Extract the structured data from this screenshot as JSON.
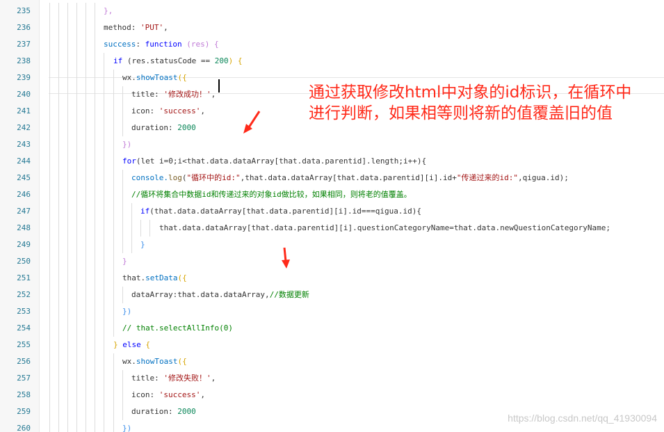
{
  "editor": {
    "lines": [
      {
        "n": "235",
        "tokens": [
          {
            "t": "},",
            "c": "br1"
          }
        ]
      },
      {
        "n": "236",
        "tokens": [
          {
            "t": "method",
            "c": "prop"
          },
          {
            "t": ": ",
            "c": ""
          },
          {
            "t": "'PUT'",
            "c": "str"
          },
          {
            "t": ",",
            "c": ""
          }
        ]
      },
      {
        "n": "237",
        "tokens": [
          {
            "t": "success",
            "c": "idt"
          },
          {
            "t": ": ",
            "c": ""
          },
          {
            "t": "function",
            "c": "kw"
          },
          {
            "t": " (res) {",
            "c": "br1"
          }
        ]
      },
      {
        "n": "238",
        "tokens": [
          {
            "t": "if",
            "c": "kw"
          },
          {
            "t": " (res.statusCode == ",
            "c": ""
          },
          {
            "t": "200",
            "c": "num"
          },
          {
            "t": ") {",
            "c": "br3"
          }
        ]
      },
      {
        "n": "239",
        "tokens": [
          {
            "t": "wx.",
            "c": ""
          },
          {
            "t": "showToast",
            "c": "idt"
          },
          {
            "t": "({",
            "c": "br3"
          }
        ]
      },
      {
        "n": "240",
        "tokens": [
          {
            "t": "title",
            "c": "prop"
          },
          {
            "t": ": ",
            "c": ""
          },
          {
            "t": "'修改成功！'",
            "c": "str"
          },
          {
            "t": ",",
            "c": ""
          }
        ]
      },
      {
        "n": "241",
        "tokens": [
          {
            "t": "icon",
            "c": "prop"
          },
          {
            "t": ": ",
            "c": ""
          },
          {
            "t": "'success'",
            "c": "str"
          },
          {
            "t": ",",
            "c": ""
          }
        ]
      },
      {
        "n": "242",
        "tokens": [
          {
            "t": "duration",
            "c": "prop"
          },
          {
            "t": ": ",
            "c": ""
          },
          {
            "t": "2000",
            "c": "num"
          }
        ]
      },
      {
        "n": "243",
        "tokens": [
          {
            "t": "})",
            "c": "br1"
          }
        ]
      },
      {
        "n": "244",
        "tokens": [
          {
            "t": "for",
            "c": "kw"
          },
          {
            "t": "(let i=0;i<that.data.dataArray[that.data.parentid].length;i++){",
            "c": ""
          }
        ]
      },
      {
        "n": "245",
        "tokens": [
          {
            "t": "console.",
            "c": "idt"
          },
          {
            "t": "log",
            "c": "fn"
          },
          {
            "t": "(",
            "c": ""
          },
          {
            "t": "\"循环中的id:\"",
            "c": "str"
          },
          {
            "t": ",that.data.dataArray[that.data.parentid][i].id+",
            "c": ""
          },
          {
            "t": "\"传递过来的id:\"",
            "c": "str"
          },
          {
            "t": ",qigua.id);",
            "c": ""
          }
        ]
      },
      {
        "n": "246",
        "tokens": [
          {
            "t": "//循环将集合中数据id和传递过来的对象id做比较，如果相同，则将老的值覆盖。",
            "c": "cmt"
          }
        ]
      },
      {
        "n": "247",
        "tokens": [
          {
            "t": "if",
            "c": "kw"
          },
          {
            "t": "(that.data.dataArray[that.data.parentid][i].id===qigua.id){",
            "c": ""
          }
        ]
      },
      {
        "n": "248",
        "tokens": [
          {
            "t": "that.data.dataArray[that.data.parentid][i].questionCategoryName=that.data.newQuestionCategoryName;",
            "c": ""
          }
        ]
      },
      {
        "n": "249",
        "tokens": [
          {
            "t": "}",
            "c": "br2"
          }
        ]
      },
      {
        "n": "250",
        "tokens": [
          {
            "t": "}",
            "c": "br1"
          }
        ]
      },
      {
        "n": "251",
        "tokens": [
          {
            "t": "that.",
            "c": ""
          },
          {
            "t": "setData",
            "c": "idt"
          },
          {
            "t": "({",
            "c": "br3"
          }
        ]
      },
      {
        "n": "252",
        "tokens": [
          {
            "t": "dataArray:that.data.dataArray,",
            "c": ""
          },
          {
            "t": "//数据更新",
            "c": "cmt"
          }
        ]
      },
      {
        "n": "253",
        "tokens": [
          {
            "t": "})",
            "c": "br2"
          }
        ]
      },
      {
        "n": "254",
        "tokens": [
          {
            "t": "// that.selectAllInfo(0)",
            "c": "cmt"
          }
        ]
      },
      {
        "n": "255",
        "tokens": [
          {
            "t": "} ",
            "c": "br3"
          },
          {
            "t": "else",
            "c": "kw"
          },
          {
            "t": " {",
            "c": "br3"
          }
        ]
      },
      {
        "n": "256",
        "tokens": [
          {
            "t": "wx.",
            "c": ""
          },
          {
            "t": "showToast",
            "c": "idt"
          },
          {
            "t": "({",
            "c": "br3"
          }
        ]
      },
      {
        "n": "257",
        "tokens": [
          {
            "t": "title",
            "c": "prop"
          },
          {
            "t": ": ",
            "c": ""
          },
          {
            "t": "'修改失败！'",
            "c": "str"
          },
          {
            "t": ",",
            "c": ""
          }
        ]
      },
      {
        "n": "258",
        "tokens": [
          {
            "t": "icon",
            "c": "prop"
          },
          {
            "t": ": ",
            "c": ""
          },
          {
            "t": "'success'",
            "c": "str"
          },
          {
            "t": ",",
            "c": ""
          }
        ]
      },
      {
        "n": "259",
        "tokens": [
          {
            "t": "duration",
            "c": "prop"
          },
          {
            "t": ": ",
            "c": ""
          },
          {
            "t": "2000",
            "c": "num"
          }
        ]
      },
      {
        "n": "260",
        "tokens": [
          {
            "t": "})",
            "c": "br2"
          }
        ]
      }
    ]
  },
  "annotation": {
    "line1": "通过获取修改html中对象的id标识，在循环中",
    "line2": "进行判断，如果相等则将新的值覆盖旧的值"
  },
  "watermark": "https://blog.csdn.net/qq_41930094",
  "colors": {
    "annotation": "#ff2a1a",
    "line_number": "#237893",
    "keyword": "#0000ff",
    "string": "#a31515"
  }
}
